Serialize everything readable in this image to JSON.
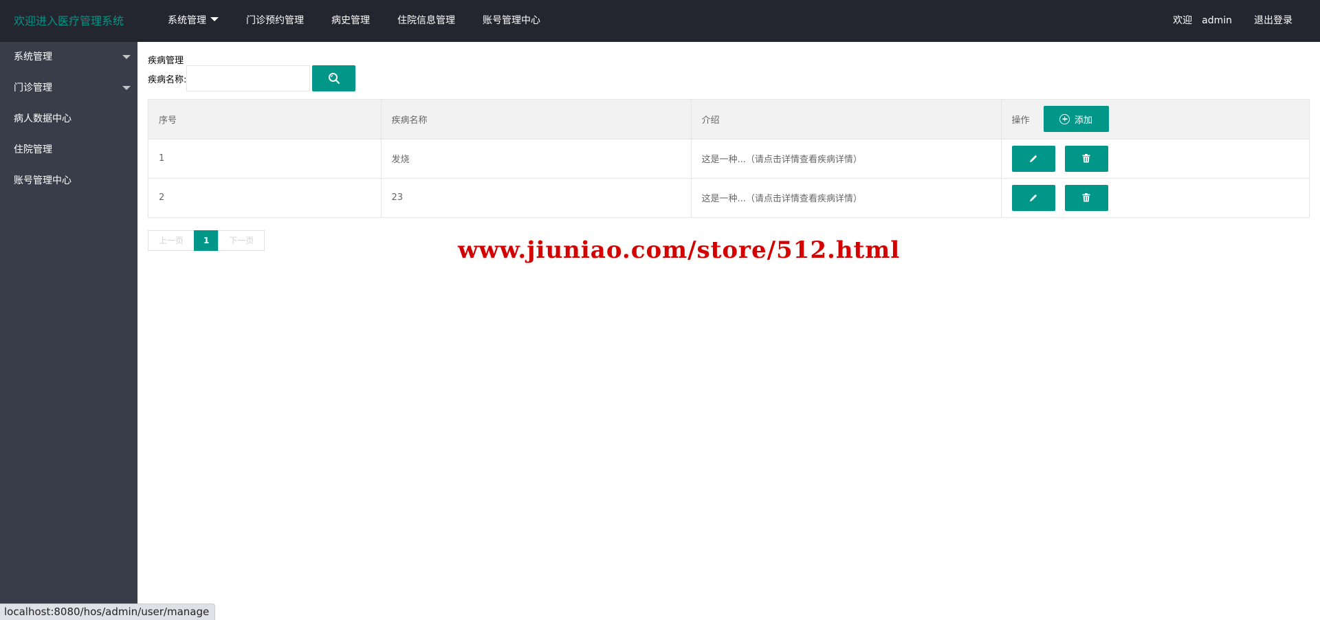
{
  "header": {
    "logo_text": "欢迎进入医疗管理系统",
    "nav": [
      {
        "label": "系统管理",
        "has_dropdown": true
      },
      {
        "label": "门诊预约管理",
        "has_dropdown": false
      },
      {
        "label": "病史管理",
        "has_dropdown": false
      },
      {
        "label": "住院信息管理",
        "has_dropdown": false
      },
      {
        "label": "账号管理中心",
        "has_dropdown": false
      }
    ],
    "welcome": "欢迎",
    "username": "admin",
    "logout": "退出登录"
  },
  "sidebar": {
    "items": [
      {
        "label": "系统管理",
        "expandable": true
      },
      {
        "label": "门诊管理",
        "expandable": true
      },
      {
        "label": "病人数据中心",
        "expandable": false
      },
      {
        "label": "住院管理",
        "expandable": false
      },
      {
        "label": "账号管理中心",
        "expandable": false
      }
    ]
  },
  "main": {
    "title": "疾病管理",
    "search": {
      "label": "疾病名称:",
      "value": "",
      "placeholder": "",
      "icon": "search-icon"
    },
    "table": {
      "headers": [
        "序号",
        "疾病名称",
        "介绍",
        "操作"
      ],
      "add_button": "添加",
      "rows": [
        {
          "index": "1",
          "name": "发烧",
          "intro": "这是一种...（请点击详情查看疾病详情）"
        },
        {
          "index": "2",
          "name": "23",
          "intro": "这是一种...（请点击详情查看疾病详情）"
        }
      ]
    },
    "pagination": {
      "prev": "上一页",
      "current": "1",
      "next": "下一页"
    }
  },
  "watermark": "www.jiuniao.com/store/512.html",
  "statusbar": "localhost:8080/hos/admin/user/manage",
  "colors": {
    "accent": "#009688",
    "header_bg": "#23262e",
    "sidebar_bg": "#393d49",
    "watermark": "#d40000"
  }
}
